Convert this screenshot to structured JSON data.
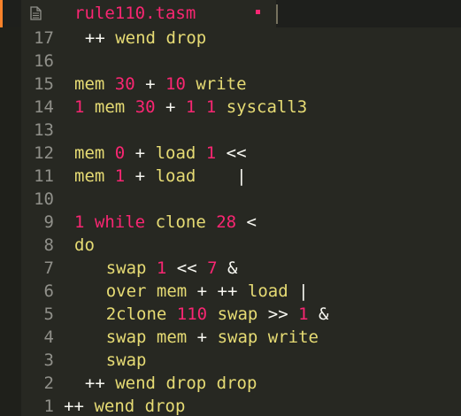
{
  "tab": {
    "title": "rule110.tasm",
    "icon": "file-icon",
    "dirty": true
  },
  "colors": {
    "background": "#272822",
    "keyword": "#e6db74",
    "number": "#f92672",
    "operator": "#f8f8f2",
    "line_number": "#90908a",
    "accent": "#f9822a"
  },
  "lines": [
    {
      "num": "17",
      "indent": 1,
      "tokens": [
        {
          "t": "++",
          "c": "w"
        },
        {
          "t": " ",
          "c": "w"
        },
        {
          "t": "wend",
          "c": "k"
        },
        {
          "t": " ",
          "c": "w"
        },
        {
          "t": "drop",
          "c": "k"
        }
      ]
    },
    {
      "num": "16",
      "indent": 0,
      "tokens": []
    },
    {
      "num": "15",
      "indent": 0,
      "tokens": [
        {
          "t": "mem",
          "c": "k"
        },
        {
          "t": " ",
          "c": "w"
        },
        {
          "t": "30",
          "c": "n"
        },
        {
          "t": " + ",
          "c": "w"
        },
        {
          "t": "10",
          "c": "n"
        },
        {
          "t": " ",
          "c": "w"
        },
        {
          "t": "write",
          "c": "k"
        }
      ]
    },
    {
      "num": "14",
      "indent": 0,
      "tokens": [
        {
          "t": "1",
          "c": "n"
        },
        {
          "t": " ",
          "c": "w"
        },
        {
          "t": "mem",
          "c": "k"
        },
        {
          "t": " ",
          "c": "w"
        },
        {
          "t": "30",
          "c": "n"
        },
        {
          "t": " + ",
          "c": "w"
        },
        {
          "t": "1",
          "c": "n"
        },
        {
          "t": " ",
          "c": "w"
        },
        {
          "t": "1",
          "c": "n"
        },
        {
          "t": " ",
          "c": "w"
        },
        {
          "t": "syscall3",
          "c": "k"
        }
      ]
    },
    {
      "num": "13",
      "indent": 0,
      "tokens": []
    },
    {
      "num": "12",
      "indent": 0,
      "tokens": [
        {
          "t": "mem",
          "c": "k"
        },
        {
          "t": " ",
          "c": "w"
        },
        {
          "t": "0",
          "c": "n"
        },
        {
          "t": " + ",
          "c": "w"
        },
        {
          "t": "load",
          "c": "k"
        },
        {
          "t": " ",
          "c": "w"
        },
        {
          "t": "1",
          "c": "n"
        },
        {
          "t": " <<",
          "c": "w"
        }
      ]
    },
    {
      "num": "11",
      "indent": 0,
      "tokens": [
        {
          "t": "mem",
          "c": "k"
        },
        {
          "t": " ",
          "c": "w"
        },
        {
          "t": "1",
          "c": "n"
        },
        {
          "t": " + ",
          "c": "w"
        },
        {
          "t": "load",
          "c": "k"
        },
        {
          "t": "    |",
          "c": "w"
        }
      ]
    },
    {
      "num": "10",
      "indent": 0,
      "tokens": []
    },
    {
      "num": "9",
      "indent": 0,
      "tokens": [
        {
          "t": "1",
          "c": "n"
        },
        {
          "t": " ",
          "c": "w"
        },
        {
          "t": "while",
          "c": "r"
        },
        {
          "t": " ",
          "c": "w"
        },
        {
          "t": "clone",
          "c": "k"
        },
        {
          "t": " ",
          "c": "w"
        },
        {
          "t": "28",
          "c": "n"
        },
        {
          "t": " <",
          "c": "w"
        }
      ]
    },
    {
      "num": "8",
      "indent": 0,
      "tokens": [
        {
          "t": "do",
          "c": "k"
        }
      ]
    },
    {
      "num": "7",
      "indent": 3,
      "tokens": [
        {
          "t": "swap",
          "c": "k"
        },
        {
          "t": " ",
          "c": "w"
        },
        {
          "t": "1",
          "c": "n"
        },
        {
          "t": " << ",
          "c": "w"
        },
        {
          "t": "7",
          "c": "n"
        },
        {
          "t": " &",
          "c": "w"
        }
      ]
    },
    {
      "num": "6",
      "indent": 3,
      "tokens": [
        {
          "t": "over",
          "c": "k"
        },
        {
          "t": " ",
          "c": "w"
        },
        {
          "t": "mem",
          "c": "k"
        },
        {
          "t": " + ++ ",
          "c": "w"
        },
        {
          "t": "load",
          "c": "k"
        },
        {
          "t": " |",
          "c": "w"
        }
      ]
    },
    {
      "num": "5",
      "indent": 3,
      "tokens": [
        {
          "t": "2clone",
          "c": "k"
        },
        {
          "t": " ",
          "c": "w"
        },
        {
          "t": "110",
          "c": "n"
        },
        {
          "t": " ",
          "c": "w"
        },
        {
          "t": "swap",
          "c": "k"
        },
        {
          "t": " >> ",
          "c": "w"
        },
        {
          "t": "1",
          "c": "n"
        },
        {
          "t": " &",
          "c": "w"
        }
      ]
    },
    {
      "num": "4",
      "indent": 3,
      "tokens": [
        {
          "t": "swap",
          "c": "k"
        },
        {
          "t": " ",
          "c": "w"
        },
        {
          "t": "mem",
          "c": "k"
        },
        {
          "t": " + ",
          "c": "w"
        },
        {
          "t": "swap",
          "c": "k"
        },
        {
          "t": " ",
          "c": "w"
        },
        {
          "t": "write",
          "c": "k"
        }
      ]
    },
    {
      "num": "3",
      "indent": 3,
      "tokens": [
        {
          "t": "swap",
          "c": "k"
        }
      ]
    },
    {
      "num": "2",
      "indent": 1,
      "tokens": [
        {
          "t": "++",
          "c": "w"
        },
        {
          "t": " ",
          "c": "w"
        },
        {
          "t": "wend",
          "c": "k"
        },
        {
          "t": " ",
          "c": "w"
        },
        {
          "t": "drop",
          "c": "k"
        },
        {
          "t": " ",
          "c": "w"
        },
        {
          "t": "drop",
          "c": "k"
        }
      ]
    },
    {
      "num": "1",
      "indent": -1,
      "tokens": [
        {
          "t": "++",
          "c": "w"
        },
        {
          "t": " ",
          "c": "w"
        },
        {
          "t": "wend",
          "c": "k"
        },
        {
          "t": " ",
          "c": "w"
        },
        {
          "t": "drop",
          "c": "k"
        }
      ]
    }
  ]
}
